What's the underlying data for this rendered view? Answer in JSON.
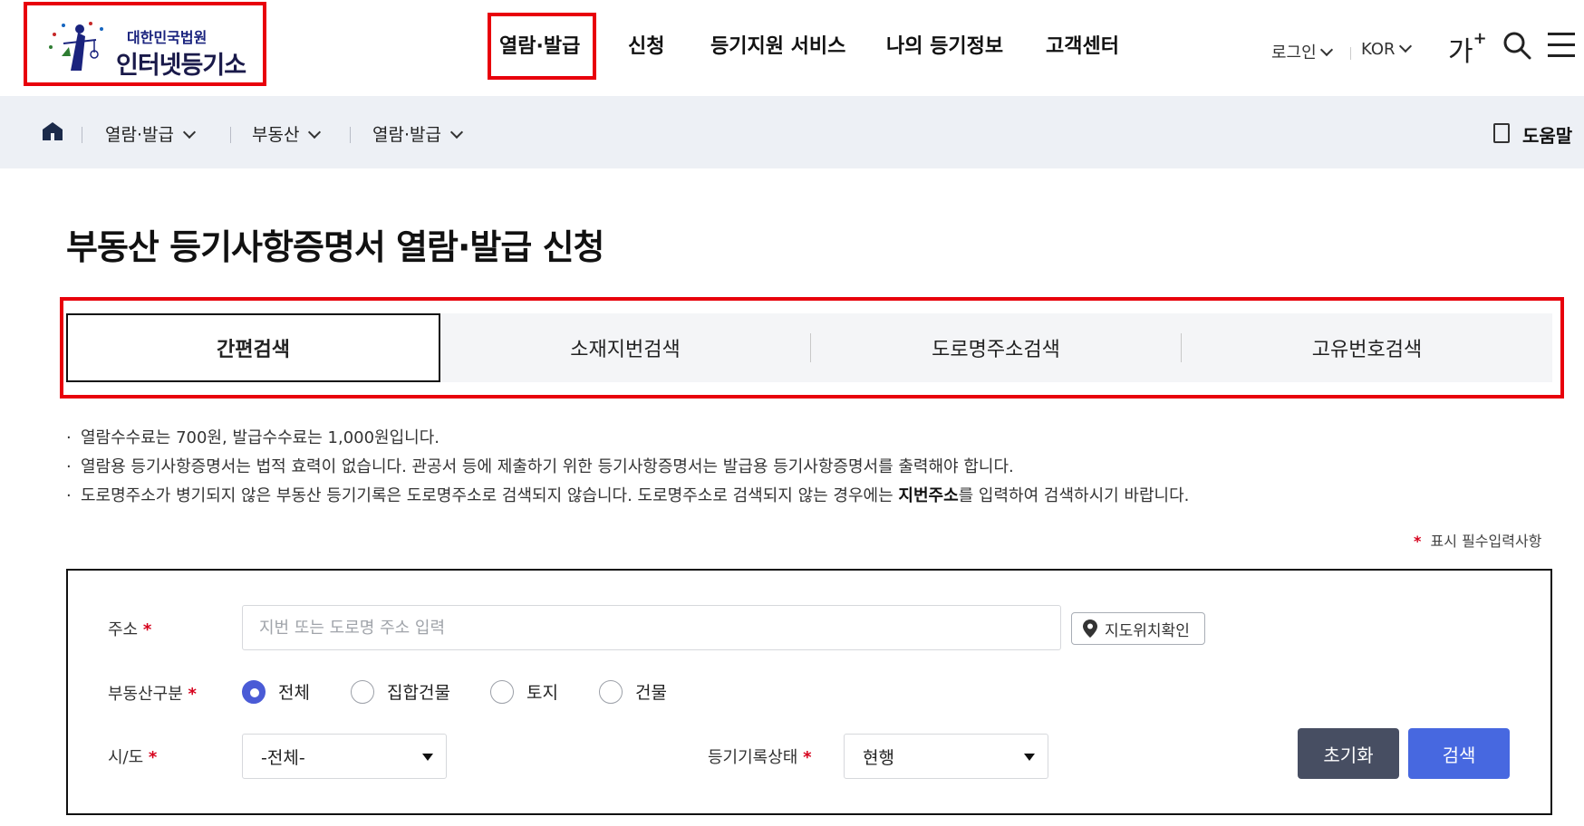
{
  "header": {
    "logo_small": "대한민국법원",
    "logo_big": "인터넷등기소",
    "nav": [
      "열람·발급",
      "신청",
      "등기지원 서비스",
      "나의 등기정보",
      "고객센터"
    ],
    "login": "로그인",
    "language": "KOR",
    "font_size_label": "가",
    "font_size_plus": "+"
  },
  "breadcrumb": {
    "items": [
      "열람·발급",
      "부동산",
      "열람·발급"
    ],
    "help": "도움말"
  },
  "page_title": "부동산 등기사항증명서 열람·발급 신청",
  "tabs": [
    "간편검색",
    "소재지번검색",
    "도로명주소검색",
    "고유번호검색"
  ],
  "active_tab": "간편검색",
  "notes": {
    "line1": "열람수수료는  700원, 발급수수료는  1,000원입니다.",
    "line2": "열람용 등기사항증명서는 법적 효력이 없습니다. 관공서 등에 제출하기 위한 등기사항증명서는 발급용 등기사항증명서를 출력해야 합니다.",
    "line3_a": "도로명주소가 병기되지 않은 부동산 등기기록은 도로명주소로 검색되지 않습니다. 도로명주소로 검색되지 않는 경우에는 ",
    "line3_b": "지번주소",
    "line3_c": "를 입력하여 검색하시기 바랍니다."
  },
  "required_mark": "*",
  "required_note": "표시 필수입력사항",
  "form": {
    "address_label": "주소",
    "address_placeholder": "지번 또는 도로명 주소 입력",
    "map_button": "지도위치확인",
    "type_label": "부동산구분",
    "type_options": [
      "전체",
      "집합건물",
      "토지",
      "건물"
    ],
    "type_selected": "전체",
    "sido_label": "시/도",
    "sido_value": "-전체-",
    "status_label": "등기기록상태",
    "status_value": "현행",
    "reset_button": "초기화",
    "search_button": "검색"
  },
  "colors": {
    "highlight": "#e8000b",
    "primary": "#4768e0",
    "reset": "#474e62",
    "required": "#d6001c"
  }
}
